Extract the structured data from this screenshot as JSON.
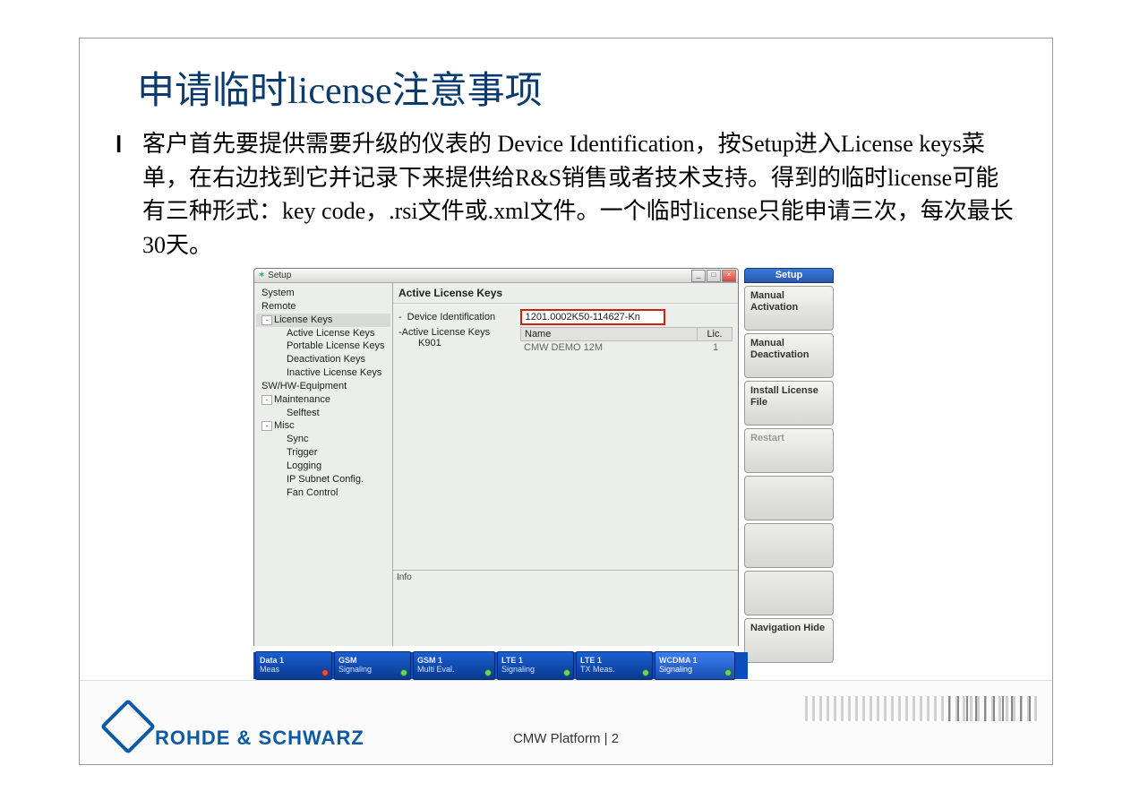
{
  "slide": {
    "title": "申请临时license注意事项",
    "body": "客户首先要提供需要升级的仪表的 Device Identification，按Setup进入License keys菜单，在右边找到它并记录下来提供给R&S销售或者技术支持。得到的临时license可能有三种形式：key code，.rsi文件或.xml文件。一个临时license只能申请三次，每次最长30天。"
  },
  "setup_window": {
    "title": "Setup",
    "tree": {
      "n0": "System",
      "n1": "Remote",
      "n2": "License Keys",
      "n2a": "Active License Keys",
      "n2b": "Portable License Keys",
      "n2c": "Deactivation Keys",
      "n2d": "Inactive License Keys",
      "n3": "SW/HW-Equipment",
      "n4": "Maintenance",
      "n4a": "Selftest",
      "n5": "Misc",
      "n5a": "Sync",
      "n5b": "Trigger",
      "n5c": "Logging",
      "n5d": "IP Subnet Config.",
      "n5e": "Fan Control"
    },
    "pane_title": "Active License Keys",
    "dev_id_label": "Device Identification",
    "dev_id_value": "1201.0002K50-114627-Kn",
    "alk": {
      "label": "Active License Keys",
      "child": "K901",
      "col_name": "Name",
      "col_lic": "Lic.",
      "row_name": "CMW DEMO 12M",
      "row_lic": "1"
    },
    "info_label": "Info"
  },
  "softkeys": {
    "header": "Setup",
    "b1": "Manual Activation",
    "b2": "Manual Deactivation",
    "b3": "Install License File",
    "b4": "Restart",
    "b5": "Navigation Hide"
  },
  "taskbar": {
    "t1a": "Data 1",
    "t1b": "Meas",
    "t2a": "GSM",
    "t2b": "Signaling",
    "t3a": "GSM 1",
    "t3b": "Multi Eval.",
    "t4a": "LTE 1",
    "t4b": "Signaling",
    "t5a": "LTE 1",
    "t5b": "TX Meas.",
    "t6a": "WCDMA 1",
    "t6b": "Signaling"
  },
  "footer": {
    "brand": "ROHDE & SCHWARZ",
    "page": "CMW Platform | 2"
  }
}
